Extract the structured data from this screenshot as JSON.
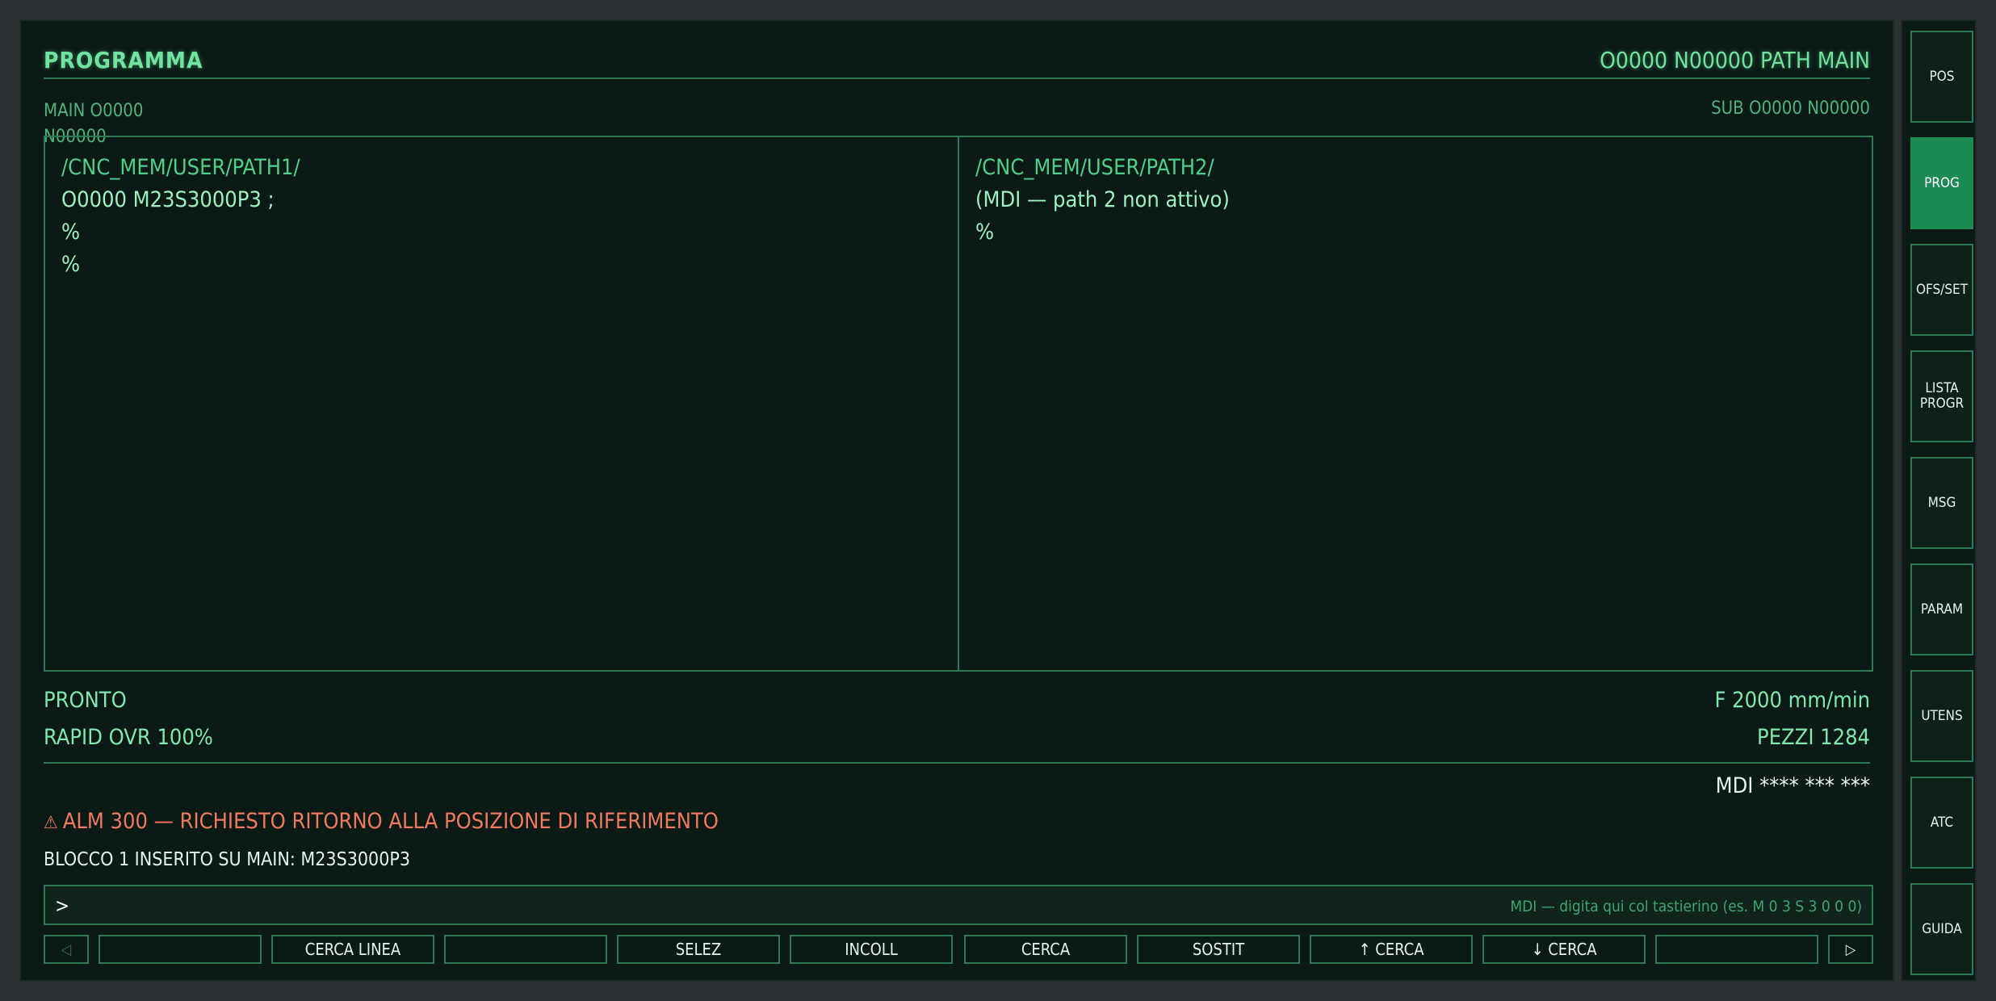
{
  "header": {
    "title": "PROGRAMMA",
    "right": "O0000 N00000 PATH MAIN"
  },
  "sub_info": {
    "main": "MAIN O0000 N00000",
    "sub": "SUB O0000 N00000"
  },
  "editor": {
    "left": {
      "path": "/CNC_MEM/USER/PATH1/",
      "lines": [
        "O0000 M23S3000P3 ;",
        "%",
        "%"
      ]
    },
    "right": {
      "path": "/CNC_MEM/USER/PATH2/",
      "lines": [
        "(MDI — path 2 non attivo)",
        "%"
      ]
    }
  },
  "status": {
    "state": "PRONTO",
    "rapid": "RAPID OVR 100%",
    "feed": "F 2000 mm/min",
    "parts": "PEZZI 1284",
    "mode": "MDI **** *** ***"
  },
  "alarm": {
    "icon": "warning-icon",
    "text": "ALM 300 — RICHIESTO RITORNO ALLA POSIZIONE DI RIFERIMENTO"
  },
  "message": "BLOCCO 1 INSERITO SU MAIN: M23S3000P3",
  "input": {
    "prompt": ">",
    "placeholder": "MDI — digita qui col tastierino (es. M 0 3 S 3 0 0 0)"
  },
  "softkeys": {
    "prev": "◁",
    "next": "▷",
    "keys": [
      "",
      "CERCA LINEA",
      "",
      "SELEZ",
      "INCOLL",
      "CERCA",
      "SOSTIT",
      "↑ CERCA",
      "↓ CERCA",
      ""
    ]
  },
  "side_buttons": [
    {
      "label": "POS",
      "active": false
    },
    {
      "label": "PROG",
      "active": true
    },
    {
      "label": "OFS/SET",
      "active": false
    },
    {
      "label": "LISTA PROGR",
      "active": false
    },
    {
      "label": "MSG",
      "active": false
    },
    {
      "label": "PARAM",
      "active": false
    },
    {
      "label": "UTENS",
      "active": false
    },
    {
      "label": "ATC",
      "active": false
    },
    {
      "label": "GUIDA",
      "active": false
    }
  ],
  "colors": {
    "screen_bg": "#0b1a15",
    "accent": "#1c8a55",
    "text_green": "#7fe8ae",
    "alarm": "#f07a60"
  }
}
